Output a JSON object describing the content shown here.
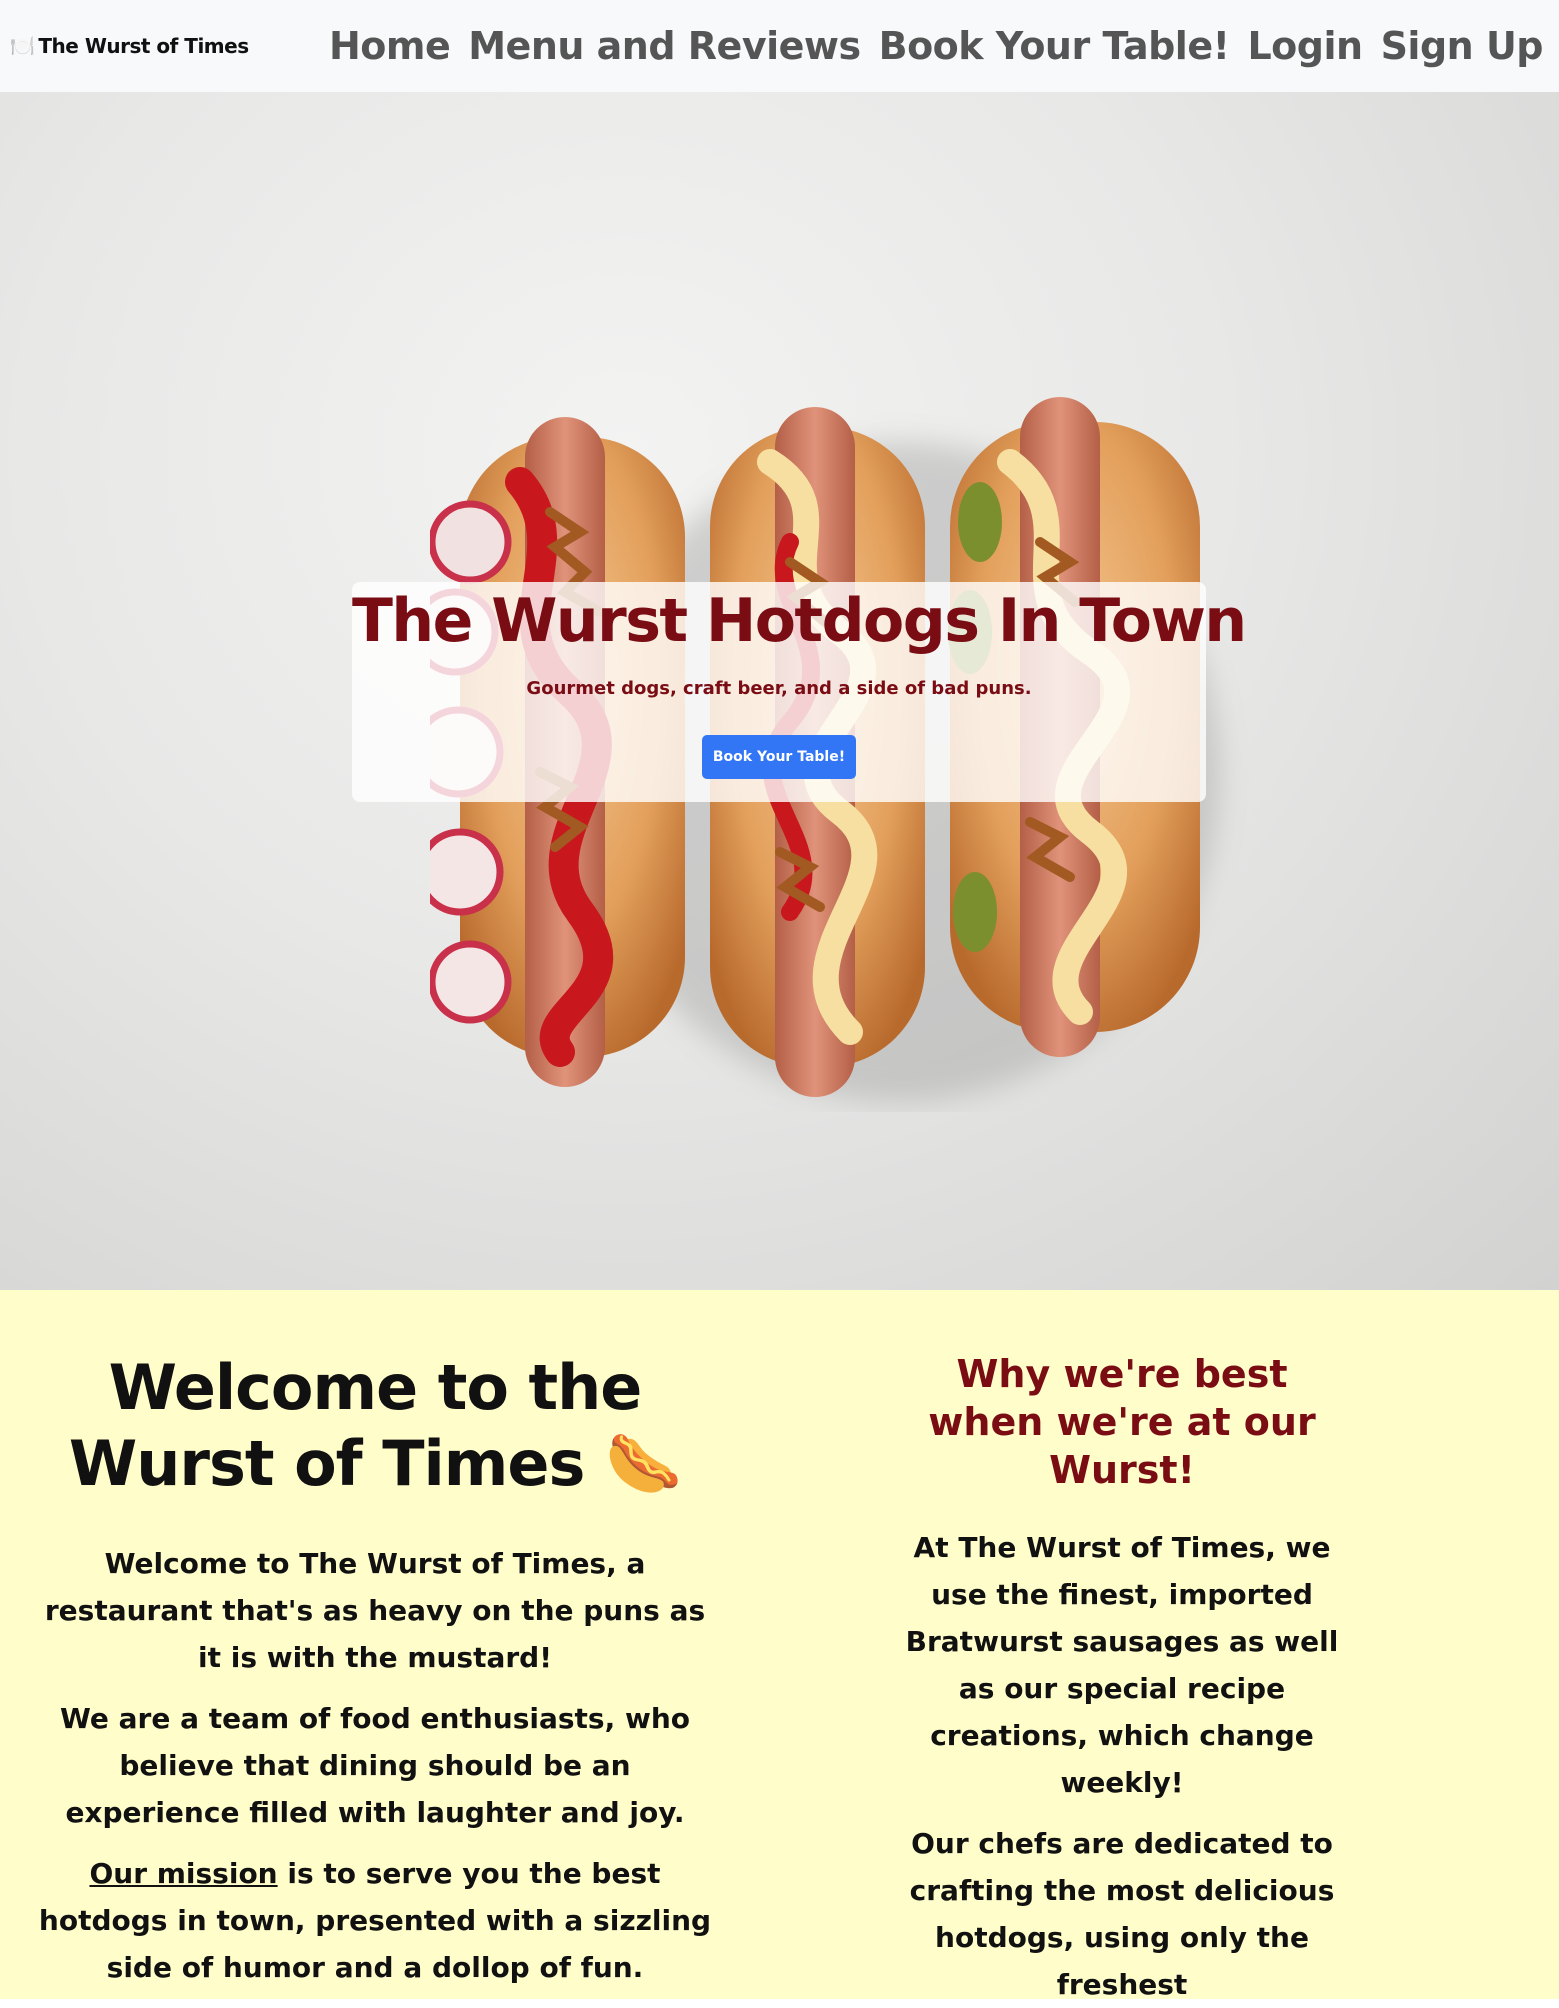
{
  "nav": {
    "brand_icon": "🍽️",
    "brand": "The Wurst of Times",
    "links": [
      "Home",
      "Menu and Reviews",
      "Book Your Table!",
      "Login",
      "Sign Up"
    ]
  },
  "hero": {
    "title": "The Wurst Hotdogs In Town",
    "subtitle": "Gourmet dogs, craft beer, and a side of bad puns.",
    "button": "Book Your Table!"
  },
  "welcome": {
    "title": "Welcome to the Wurst of Times",
    "title_emoji": "🌭",
    "p1": "Welcome to The Wurst of Times, a restaurant that's as heavy on the puns as it is with the mustard!",
    "p2": "We are a team of food enthusiasts, who believe that dining should be an experience filled with laughter and joy.",
    "mission_link": "Our mission",
    "p3_rest": " is to serve you the best hotdogs in town, presented with a sizzling side of humor and a dollop of fun."
  },
  "why": {
    "title": "Why we're best when we're at our Wurst!",
    "p1": "At The Wurst of Times, we use the finest, imported Bratwurst sausages as well as our special recipe creations, which change weekly!",
    "p2": "Our chefs are dedicated to crafting the most delicious hotdogs, using only the freshest"
  },
  "colors": {
    "brand_red": "#7a0c14",
    "button_blue": "#3276f5",
    "content_bg": "#fffdca",
    "navbar_bg": "#f8f9fa"
  }
}
